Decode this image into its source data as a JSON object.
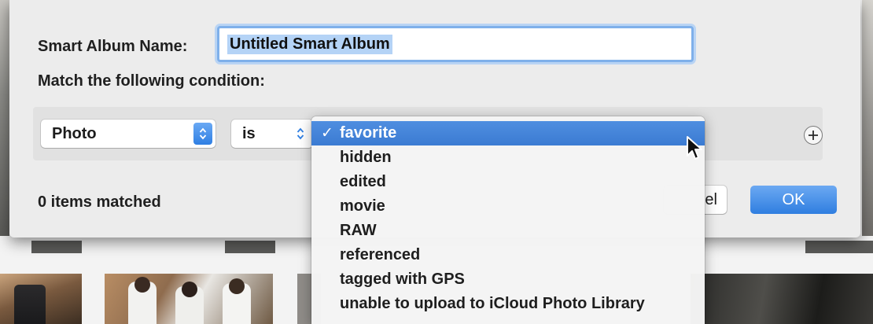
{
  "dialog": {
    "name_label": "Smart Album Name:",
    "name_value": "Untitled Smart Album",
    "match_label": "Match the following condition:",
    "condition": {
      "field_value": "Photo",
      "operator_value": "is",
      "add_icon": "plus-circle-icon"
    },
    "items_matched": "0 items matched",
    "cancel_label": "el",
    "ok_label": "OK"
  },
  "menu": {
    "items": [
      {
        "label": "favorite",
        "selected": true
      },
      {
        "label": "hidden",
        "selected": false
      },
      {
        "label": "edited",
        "selected": false
      },
      {
        "label": "movie",
        "selected": false
      },
      {
        "label": "RAW",
        "selected": false
      },
      {
        "label": "referenced",
        "selected": false
      },
      {
        "label": "tagged with GPS",
        "selected": false
      },
      {
        "label": "unable to upload to iCloud Photo Library",
        "selected": false
      }
    ],
    "check_glyph": "✓"
  },
  "colors": {
    "accent": "#3b7bd2",
    "dialog_bg": "#ececec",
    "focus_ring": "#7fb0ea"
  }
}
